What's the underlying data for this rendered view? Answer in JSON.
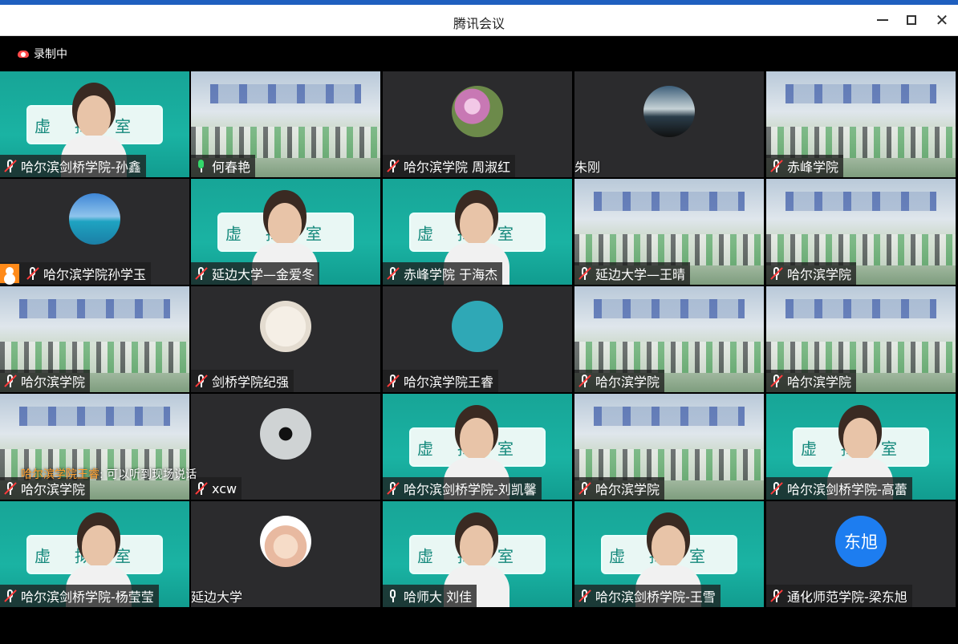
{
  "window": {
    "title": "腾讯会议",
    "minimize_label": "minimize",
    "maximize_label": "maximize",
    "close_label": "close"
  },
  "recording": {
    "label": "录制中"
  },
  "chat_toast": {
    "sender": "哈尔滨学院王睿",
    "separator": ": ",
    "message": "可以听到现场说话"
  },
  "tiles": [
    {
      "name": "哈尔滨剑桥学院-孙鑫",
      "mic": "muted",
      "view": "banner-person"
    },
    {
      "name": "何春艳",
      "mic": "on",
      "view": "classroom",
      "active": true
    },
    {
      "name": "哈尔滨学院 周淑红",
      "mic": "muted",
      "view": "avatar-flower"
    },
    {
      "name": "朱刚",
      "mic": "none",
      "view": "avatar-sea"
    },
    {
      "name": "赤峰学院",
      "mic": "muted",
      "view": "classroom"
    },
    {
      "name": "哈尔滨学院孙学玉",
      "mic": "muted",
      "view": "avatar-ocean",
      "host_icon": true
    },
    {
      "name": "延边大学—金爱冬",
      "mic": "muted",
      "view": "banner-person"
    },
    {
      "name": "赤峰学院 于海杰",
      "mic": "muted",
      "view": "banner-person"
    },
    {
      "name": "延边大学—王晴",
      "mic": "muted",
      "view": "classroom"
    },
    {
      "name": "哈尔滨学院",
      "mic": "muted",
      "view": "classroom"
    },
    {
      "name": "哈尔滨学院",
      "mic": "muted",
      "view": "classroom"
    },
    {
      "name": "剑桥学院纪强",
      "mic": "muted",
      "view": "avatar-drawing"
    },
    {
      "name": "哈尔滨学院王睿",
      "mic": "muted",
      "view": "avatar-cartoon"
    },
    {
      "name": "哈尔滨学院",
      "mic": "muted",
      "view": "classroom"
    },
    {
      "name": "哈尔滨学院",
      "mic": "muted",
      "view": "classroom"
    },
    {
      "name": "哈尔滨学院",
      "mic": "muted",
      "view": "classroom"
    },
    {
      "name": "xcw",
      "mic": "muted",
      "view": "avatar-butterfly"
    },
    {
      "name": "哈尔滨剑桥学院-刘凯馨",
      "mic": "muted",
      "view": "banner-person"
    },
    {
      "name": "哈尔滨学院",
      "mic": "muted",
      "view": "classroom"
    },
    {
      "name": "哈尔滨剑桥学院-高蕾",
      "mic": "muted",
      "view": "banner-person"
    },
    {
      "name": "哈尔滨剑桥学院-杨莹莹",
      "mic": "muted",
      "view": "banner-person"
    },
    {
      "name": "延边大学",
      "mic": "none",
      "view": "avatar-girl"
    },
    {
      "name": "哈师大 刘佳",
      "mic": "on-white",
      "view": "banner-person"
    },
    {
      "name": "哈尔滨剑桥学院-王雪",
      "mic": "muted",
      "view": "banner-person"
    },
    {
      "name": "通化师范学院-梁东旭",
      "mic": "muted",
      "view": "avatar-letter",
      "avatar_text": "东旭"
    }
  ],
  "banner_text": "虚拟室"
}
